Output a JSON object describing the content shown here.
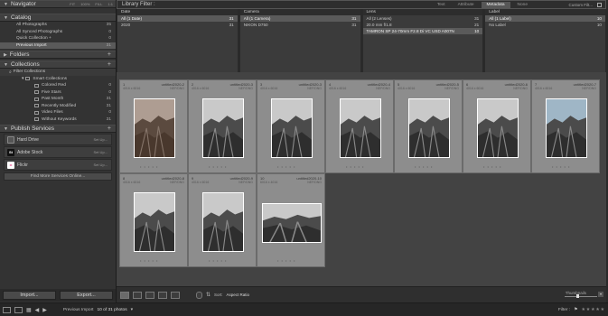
{
  "navigator": {
    "title": "Navigator",
    "opts": [
      "FIT",
      "100%",
      "FILL",
      "1:1"
    ]
  },
  "catalog": {
    "title": "Catalog",
    "items": [
      {
        "label": "All Photographs",
        "count": "35"
      },
      {
        "label": "All Synced Photographs",
        "count": "0"
      },
      {
        "label": "Quick Collection +",
        "count": "0"
      },
      {
        "label": "Previous Import",
        "count": "31"
      }
    ]
  },
  "folders": {
    "title": "Folders"
  },
  "collections": {
    "title": "Collections",
    "filter": "Filter Collections",
    "smart": "Smart Collections",
    "items": [
      {
        "label": "Colored Red",
        "count": "0"
      },
      {
        "label": "Five Stars",
        "count": "0"
      },
      {
        "label": "Past Month",
        "count": "31"
      },
      {
        "label": "Recently Modified",
        "count": "31"
      },
      {
        "label": "Video Files",
        "count": "0"
      },
      {
        "label": "Without Keywords",
        "count": "31"
      }
    ]
  },
  "publish": {
    "title": "Publish Services",
    "services": [
      {
        "label": "Hard Drive",
        "badge": "",
        "color": "#4a4a4a",
        "setup": "Set Up..."
      },
      {
        "label": "Adobe Stock",
        "badge": "St",
        "color": "#1a1a1a",
        "setup": "Set Up..."
      },
      {
        "label": "Flickr",
        "badge": "••",
        "color": "#ffffff",
        "setup": "Set Up..."
      }
    ],
    "find": "Find More Services Online..."
  },
  "buttons": {
    "import": "Import...",
    "export": "Export..."
  },
  "filter": {
    "title": "Library Filter :",
    "tabs": [
      "Text",
      "Attribute",
      "Metadata",
      "None"
    ],
    "active_tab": "Metadata",
    "preset": "Custom Filt...",
    "columns": [
      {
        "header": "Date",
        "rows": [
          {
            "label": "All (1 Date)",
            "count": "31"
          },
          {
            "label": "2020",
            "count": "31"
          }
        ],
        "sel": 0
      },
      {
        "header": "Camera",
        "rows": [
          {
            "label": "All (1 Camera)",
            "count": "31"
          },
          {
            "label": "NIKON D750",
            "count": "31"
          }
        ],
        "sel": 0
      },
      {
        "header": "Lens",
        "rows": [
          {
            "label": "All (2 Lenses)",
            "count": "31"
          },
          {
            "label": "20.0 mm f/1.8",
            "count": "21"
          },
          {
            "label": "TAMRON SP 24-70mm F2.8 Di VC USD A007N",
            "count": "10"
          }
        ],
        "sel": 2
      },
      {
        "header": "Label",
        "rows": [
          {
            "label": "All (1 Label)",
            "count": "10"
          },
          {
            "label": "No Label",
            "count": "10"
          }
        ],
        "sel": 0
      }
    ]
  },
  "photos": [
    {
      "num": "1",
      "file": "untitled2020-2",
      "dims": "4016 x 6016",
      "type": "NEF/DNG"
    },
    {
      "num": "2",
      "file": "untitled2020-3",
      "dims": "4016 x 6016",
      "type": "NEF/DNG"
    },
    {
      "num": "3",
      "file": "untitled2020-3",
      "dims": "4016 x 6016",
      "type": "NEF/DNG"
    },
    {
      "num": "4",
      "file": "untitled2020-4",
      "dims": "4016 x 6016",
      "type": "NEF/DNG"
    },
    {
      "num": "5",
      "file": "untitled2020-5",
      "dims": "4016 x 6016",
      "type": "NEF/DNG"
    },
    {
      "num": "6",
      "file": "untitled2020-6",
      "dims": "4016 x 6016",
      "type": "NEF/DNG"
    },
    {
      "num": "7",
      "file": "untitled2020-7",
      "dims": "4016 x 6016",
      "type": "NEF/DNG"
    },
    {
      "num": "8",
      "file": "untitled2020-8",
      "dims": "4016 x 6016",
      "type": "NEF/DNG"
    },
    {
      "num": "9",
      "file": "untitled2020-9",
      "dims": "4016 x 6016",
      "type": "NEF/DNG"
    },
    {
      "num": "10",
      "file": "untitled2020-10",
      "dims": "6016 x 4016",
      "type": "NEF/DNG"
    }
  ],
  "toolbar": {
    "sort_label": "Sort:",
    "sort_value": "Aspect Ratio",
    "thumbs_label": "Thumbnails"
  },
  "filmstrip": {
    "source": "Previous Import",
    "count": "10 of 31 photos",
    "filter_label": "Filter :"
  }
}
